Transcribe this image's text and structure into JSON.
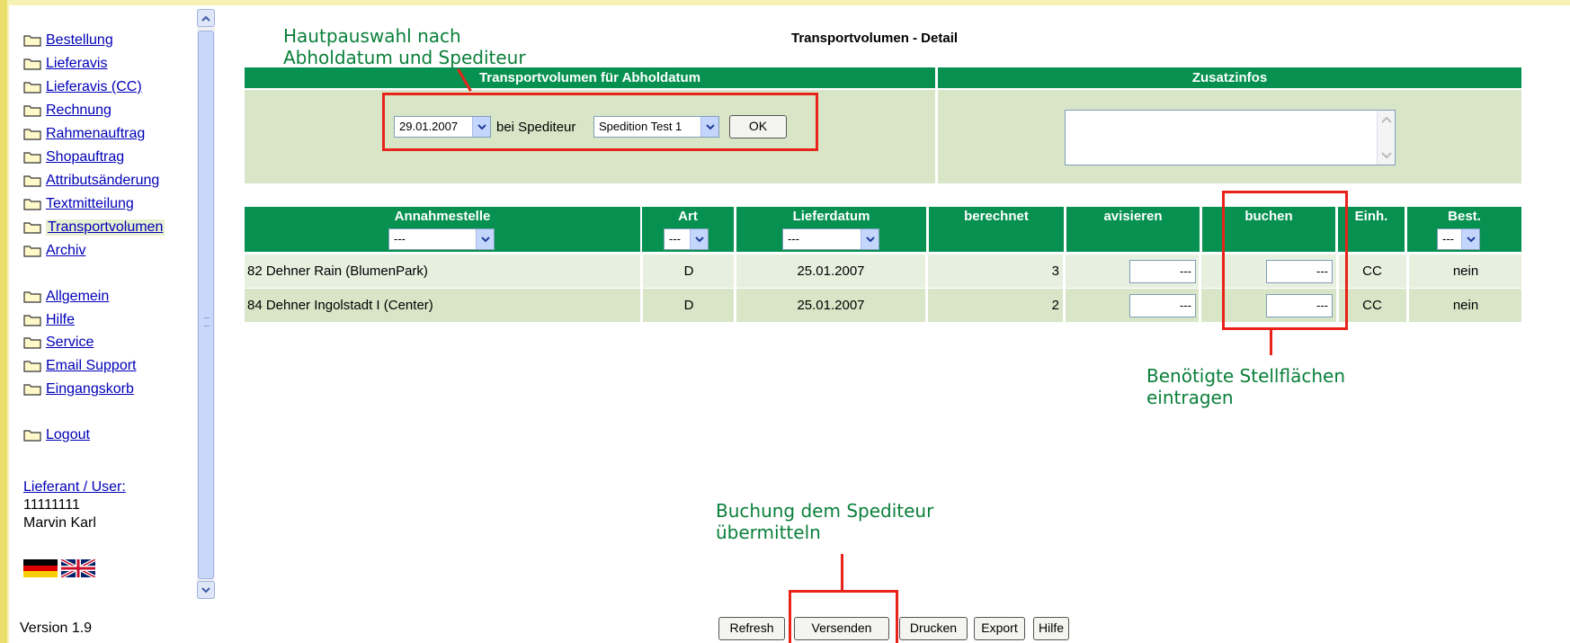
{
  "sidebar": {
    "items": [
      {
        "label": "Bestellung"
      },
      {
        "label": "Lieferavis"
      },
      {
        "label": "Lieferavis (CC)"
      },
      {
        "label": "Rechnung"
      },
      {
        "label": "Rahmenauftrag"
      },
      {
        "label": "Shopauftrag"
      },
      {
        "label": "Attributsänderung"
      },
      {
        "label": "Textmitteilung"
      },
      {
        "label": "Transportvolumen",
        "active": true
      },
      {
        "label": "Archiv"
      }
    ],
    "items2": [
      {
        "label": "Allgemein"
      },
      {
        "label": "Hilfe"
      },
      {
        "label": "Service"
      },
      {
        "label": "Email Support"
      },
      {
        "label": "Eingangskorb"
      }
    ],
    "logout": "Logout",
    "user_label": "Lieferant / User:",
    "user_id": "11111111",
    "user_name": "Marvin Karl",
    "version": "Version 1.9"
  },
  "page": {
    "title": "Transportvolumen - Detail",
    "left_header": "Transportvolumen für Abholdatum",
    "right_header": "Zusatzinfos",
    "date_value": "29.01.2007",
    "bei_label": "bei Spediteur",
    "carrier_value": "Spedition Test 1",
    "ok_label": "OK"
  },
  "table": {
    "columns": [
      "Annahmestelle",
      "Art",
      "Lieferdatum",
      "berechnet",
      "avisieren",
      "buchen",
      "Einh.",
      "Best."
    ],
    "filter_default": "---",
    "rows": [
      {
        "annahmestelle": "82 Dehner Rain (BlumenPark)",
        "art": "D",
        "lieferdatum": "25.01.2007",
        "berechnet": "3",
        "avisieren": "---",
        "buchen": "---",
        "einh": "CC",
        "best": "nein"
      },
      {
        "annahmestelle": "84 Dehner Ingolstadt I (Center)",
        "art": "D",
        "lieferdatum": "25.01.2007",
        "berechnet": "2",
        "avisieren": "---",
        "buchen": "---",
        "einh": "CC",
        "best": "nein"
      }
    ]
  },
  "buttons": {
    "refresh": "Refresh",
    "versenden": "Versenden",
    "drucken": "Drucken",
    "export": "Export",
    "hilfe": "Hilfe"
  },
  "annotations": {
    "top_line1": "Hautpauswahl nach",
    "top_line2": "Abholdatum und Spediteur",
    "right_line1": "Benötigte Stellflächen",
    "right_line2": "eintragen",
    "bottom_line1": "Buchung dem Spediteur",
    "bottom_line2": "übermitteln"
  },
  "colors": {
    "header_green": "#069150",
    "panel_green": "#d8e6c7",
    "annotation_green": "#0a7f3a",
    "highlight_red": "#e8231a"
  }
}
